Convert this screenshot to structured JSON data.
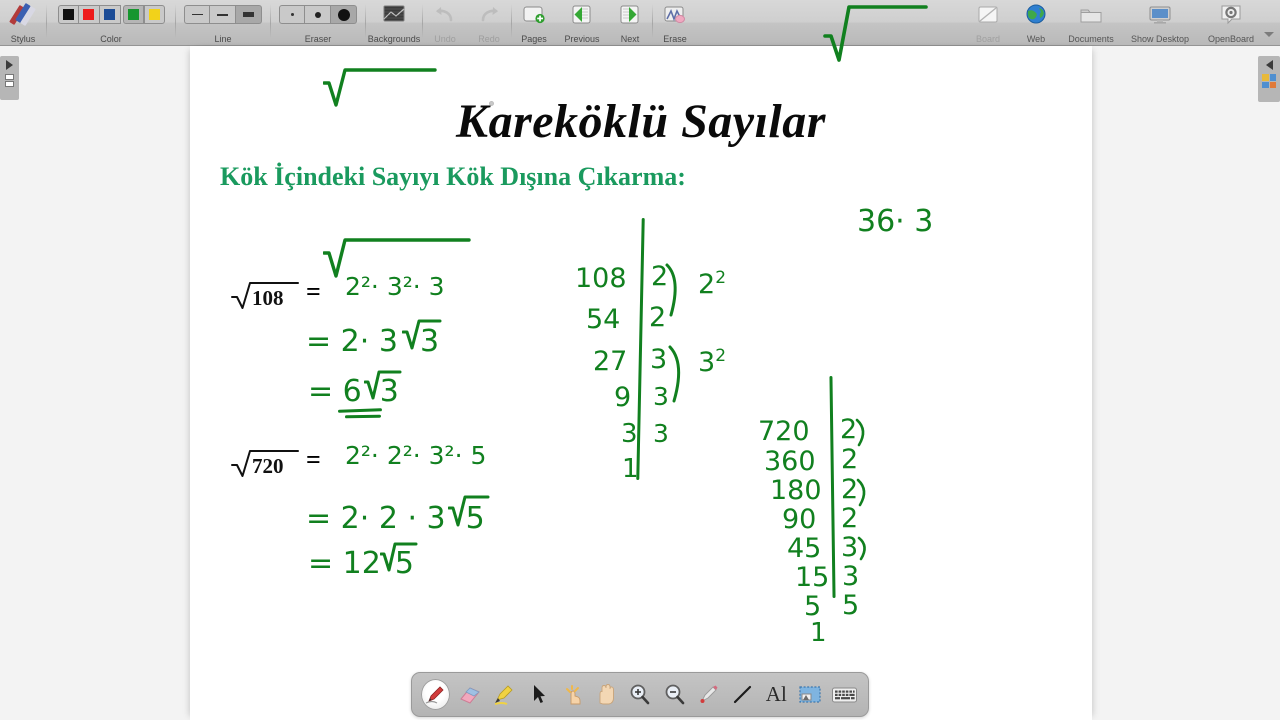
{
  "app": {
    "name": "OpenBoard"
  },
  "toolbar": {
    "groups": [
      {
        "label": "Stylus"
      },
      {
        "label": "Color"
      },
      {
        "label": "Line"
      },
      {
        "label": "Eraser"
      }
    ],
    "colors": [
      {
        "name": "black",
        "hex": "#111111"
      },
      {
        "name": "red",
        "hex": "#ee1b1b"
      },
      {
        "name": "blue",
        "hex": "#1c4c96"
      },
      {
        "name": "green",
        "hex": "#17962f",
        "selected": true
      },
      {
        "name": "yellow",
        "hex": "#f2d21a"
      }
    ],
    "buttons": [
      {
        "name": "backgrounds",
        "label": "Backgrounds",
        "enabled": true
      },
      {
        "name": "undo",
        "label": "Undo",
        "enabled": false
      },
      {
        "name": "redo",
        "label": "Redo",
        "enabled": false
      },
      {
        "name": "pages",
        "label": "Pages",
        "enabled": true
      },
      {
        "name": "previous",
        "label": "Previous",
        "enabled": true
      },
      {
        "name": "next",
        "label": "Next",
        "enabled": true
      },
      {
        "name": "erase",
        "label": "Erase",
        "enabled": true
      }
    ],
    "right_buttons": [
      {
        "name": "board",
        "label": "Board",
        "active": false
      },
      {
        "name": "web",
        "label": "Web",
        "active": true
      },
      {
        "name": "documents",
        "label": "Documents",
        "active": true
      },
      {
        "name": "show-desktop",
        "label": "Show Desktop",
        "active": true
      },
      {
        "name": "openboard",
        "label": "OpenBoard",
        "active": true
      }
    ]
  },
  "board": {
    "title": "Kareköklü Sayılar",
    "subtitle": "Kök İçindeki Sayıyı Kök Dışına Çıkarma:",
    "subtitle_color": "#1a9a5e",
    "ink_color": "#11801f",
    "examples": [
      {
        "lhs": "108",
        "lines": [
          "2² · 3² · 3",
          "= 2 · 3 · √3",
          "= 6√3"
        ],
        "inside_root": "2²· 3²· 3",
        "step2_prefix": "= 2",
        "step2_mid": "· 3",
        "step2_root": "3",
        "step3_prefix": "= 6",
        "step3_root": "3"
      },
      {
        "lhs": "720",
        "inside_root": "2²· 2²· 3²· 5",
        "step2_prefix": "= 2",
        "step2_mid": "· 2 · 3",
        "step2_root": "5",
        "step3_prefix": "= 12",
        "step3_root": "5"
      }
    ],
    "factor_trees": [
      {
        "name": "108",
        "rows": [
          {
            "value": "108",
            "factor": "2"
          },
          {
            "value": "54",
            "factor": "2"
          },
          {
            "value": "27",
            "factor": "3"
          },
          {
            "value": "9",
            "factor": "3"
          },
          {
            "value": "3",
            "factor": "3"
          },
          {
            "value": "1",
            "factor": ""
          }
        ],
        "annotations": [
          {
            "text": "2",
            "exp": "2"
          },
          {
            "text": "3",
            "exp": "2"
          }
        ]
      },
      {
        "name": "720",
        "rows": [
          {
            "value": "720",
            "factor": "2"
          },
          {
            "value": "360",
            "factor": "2"
          },
          {
            "value": "180",
            "factor": "2"
          },
          {
            "value": "90",
            "factor": "2"
          },
          {
            "value": "45",
            "factor": "3"
          },
          {
            "value": "15",
            "factor": "3"
          },
          {
            "value": "5",
            "factor": "5"
          },
          {
            "value": "1",
            "factor": ""
          }
        ]
      }
    ],
    "side_note": {
      "inside_root": "36· 3"
    }
  },
  "bottom_tools": [
    {
      "name": "pen-tool",
      "active": true
    },
    {
      "name": "eraser-tool",
      "active": false
    },
    {
      "name": "highlighter-tool",
      "active": false
    },
    {
      "name": "select-tool",
      "active": false
    },
    {
      "name": "interactive-hand-tool",
      "active": false
    },
    {
      "name": "pan-tool",
      "active": false
    },
    {
      "name": "zoom-in-tool",
      "active": false
    },
    {
      "name": "zoom-out-tool",
      "active": false
    },
    {
      "name": "laser-pointer-tool",
      "active": false
    },
    {
      "name": "line-tool",
      "active": false
    },
    {
      "name": "text-tool",
      "active": false,
      "glyph": "Al"
    },
    {
      "name": "capture-tool",
      "active": false
    },
    {
      "name": "virtual-keyboard-tool",
      "active": false
    }
  ]
}
